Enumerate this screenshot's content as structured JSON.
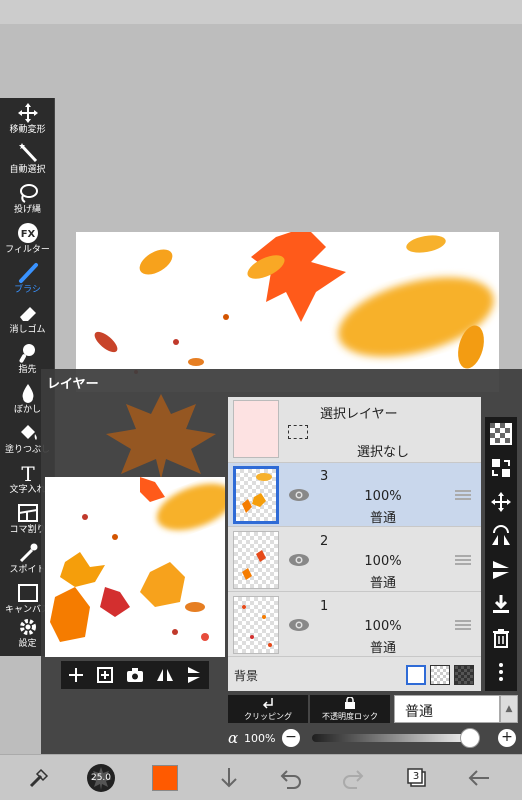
{
  "toolbar": {
    "tools": [
      {
        "label": "移動変形",
        "icon": "move-icon"
      },
      {
        "label": "自動選択",
        "icon": "magic-wand-icon"
      },
      {
        "label": "投げ縄",
        "icon": "lasso-icon"
      },
      {
        "label": "フィルター",
        "icon": "fx-icon"
      },
      {
        "label": "ブラシ",
        "icon": "brush-icon",
        "active": true
      },
      {
        "label": "消しゴム",
        "icon": "eraser-icon"
      },
      {
        "label": "指先",
        "icon": "finger-icon"
      },
      {
        "label": "ぼかし",
        "icon": "blur-drop-icon"
      },
      {
        "label": "塗りつぶし",
        "icon": "bucket-icon"
      },
      {
        "label": "文字入れ",
        "icon": "text-icon"
      },
      {
        "label": "コマ割り",
        "icon": "frame-divider-icon"
      },
      {
        "label": "スポイト",
        "icon": "eyedropper-icon"
      },
      {
        "label": "キャンバス",
        "icon": "canvas-icon"
      },
      {
        "label": "設定",
        "icon": "gear-icon"
      }
    ]
  },
  "layer_panel": {
    "title": "レイヤー",
    "selection_layer": {
      "name": "選択レイヤー",
      "status": "選択なし"
    },
    "layers": [
      {
        "number": "3",
        "opacity": "100%",
        "mode": "普通",
        "selected": true
      },
      {
        "number": "2",
        "opacity": "100%",
        "mode": "普通",
        "selected": false
      },
      {
        "number": "1",
        "opacity": "100%",
        "mode": "普通",
        "selected": false
      }
    ],
    "background_label": "背景",
    "clipping_label": "クリッピング",
    "lock_label": "不透明度ロック",
    "blend_mode": "普通",
    "alpha_symbol": "α",
    "alpha_value": "100%",
    "alpha_level": 1.0,
    "minus": "−",
    "plus": "+"
  },
  "bottom_bar": {
    "brush_size": "25.0",
    "current_color": "#ff5a00",
    "layer_count": "3"
  },
  "colors": {
    "accent": "#2f6bd6",
    "selected_row": "#c9d7ec",
    "brush_active": "#3a93ff"
  }
}
